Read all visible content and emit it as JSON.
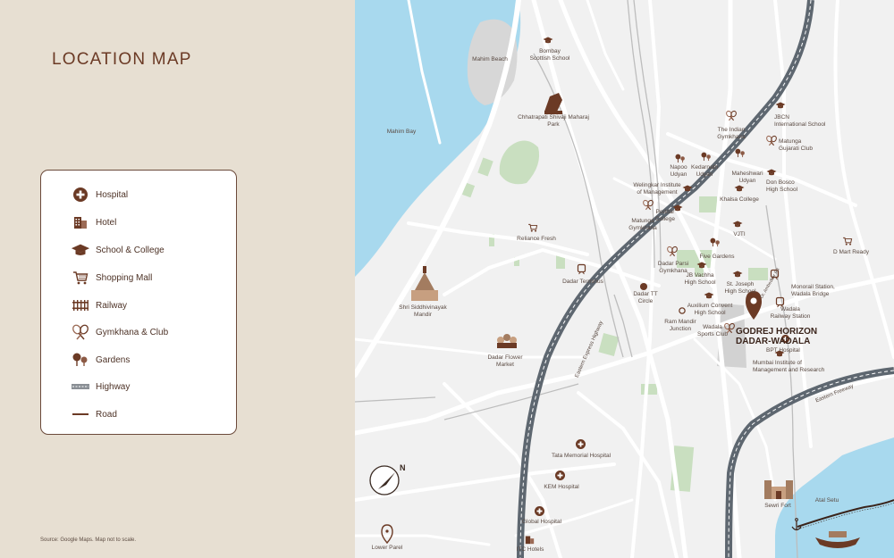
{
  "title": "LOCATION MAP",
  "legend": [
    {
      "label": "Hospital",
      "icon": "hospital-icon"
    },
    {
      "label": "Hotel",
      "icon": "hotel-icon"
    },
    {
      "label": "School & College",
      "icon": "school-icon"
    },
    {
      "label": "Shopping Mall",
      "icon": "shopping-cart-icon"
    },
    {
      "label": "Railway",
      "icon": "railway-icon"
    },
    {
      "label": "Gymkhana & Club",
      "icon": "tennis-racket-icon"
    },
    {
      "label": "Gardens",
      "icon": "tree-icon"
    },
    {
      "label": "Highway",
      "icon": "dashed-line-icon"
    },
    {
      "label": "Road",
      "icon": "solid-line-icon"
    }
  ],
  "source_note": "Source: Google Maps. Map not to scale.",
  "colors": {
    "brand": "#6b3a25",
    "water": "#a8d9ee",
    "park": "#c9dfc0",
    "highway": "#5e6770",
    "road": "#ffffff",
    "map_bg": "#f1f1f1",
    "panel_bg": "#e7dfd2"
  },
  "project": {
    "name": "GODREJ HORIZON",
    "subtitle": "DADAR-WADALA"
  },
  "compass": {
    "label": "N"
  },
  "road_labels": {
    "eastern_express": "Eastern Express Highway",
    "eastern_freeway": "Eastern Freeway",
    "dadar_tt_road": "Dr. Ambedkar Rd"
  },
  "places": [
    {
      "name": "Mahim Beach",
      "type": "area"
    },
    {
      "name": "Mahim Bay",
      "type": "water"
    },
    {
      "name": "Bombay\nScottish School",
      "type": "school"
    },
    {
      "name": "Chhatrapati Shivaji Maharaj\nPark",
      "type": "monument"
    },
    {
      "name": "Reliance Fresh",
      "type": "mall"
    },
    {
      "name": "Dadar Terminus",
      "type": "railway"
    },
    {
      "name": "Shri Siddhivinayak\nMandir",
      "type": "monument"
    },
    {
      "name": "Dadar Flower\nMarket",
      "type": "monument"
    },
    {
      "name": "Tata Memorial Hospital",
      "type": "hospital"
    },
    {
      "name": "KEM Hospital",
      "type": "hospital"
    },
    {
      "name": "Global Hospital",
      "type": "hospital"
    },
    {
      "name": "ITC Hotels",
      "type": "hotel"
    },
    {
      "name": "Lower Parel",
      "type": "pin"
    },
    {
      "name": "Sewri Fort",
      "type": "monument"
    },
    {
      "name": "Atal Setu",
      "type": "bridge"
    },
    {
      "name": "D Mart Ready",
      "type": "mall"
    },
    {
      "name": "JBCN\nInternational School",
      "type": "school"
    },
    {
      "name": "The Indian\nGymkhana",
      "type": "club"
    },
    {
      "name": "Matunga\nGujarati Club",
      "type": "club"
    },
    {
      "name": "Napoo\nUdyan",
      "type": "garden"
    },
    {
      "name": "Kedarnath\nUdyan",
      "type": "garden"
    },
    {
      "name": "Maheshwari\nUdyan",
      "type": "garden"
    },
    {
      "name": "Don Bosco\nHigh School",
      "type": "school"
    },
    {
      "name": "Welingkar Institute\nof Management",
      "type": "school"
    },
    {
      "name": "Khalsa College",
      "type": "school"
    },
    {
      "name": "Poddar\nCollege",
      "type": "school"
    },
    {
      "name": "Matunga\nGymkhana",
      "type": "club"
    },
    {
      "name": "VJTI",
      "type": "school"
    },
    {
      "name": "Five Gardens",
      "type": "garden"
    },
    {
      "name": "Dadar Parsi\nGymkhana",
      "type": "club"
    },
    {
      "name": "JB Vachha\nHigh School",
      "type": "school"
    },
    {
      "name": "Dadar TT\nCircle",
      "type": "landmark"
    },
    {
      "name": "St. Joseph\nHigh School",
      "type": "school"
    },
    {
      "name": "Monorail Station,\nWadala Bridge",
      "type": "railway"
    },
    {
      "name": "Auxilium Convent\nHigh School",
      "type": "school"
    },
    {
      "name": "Ram Mandir\nJunction",
      "type": "landmark"
    },
    {
      "name": "Wadala\nSports Club",
      "type": "club"
    },
    {
      "name": "Wadala\nRailway Station",
      "type": "railway"
    },
    {
      "name": "BPT Hospital",
      "type": "hospital"
    },
    {
      "name": "Mumbai Institute of\nManagement and Research",
      "type": "school"
    }
  ]
}
